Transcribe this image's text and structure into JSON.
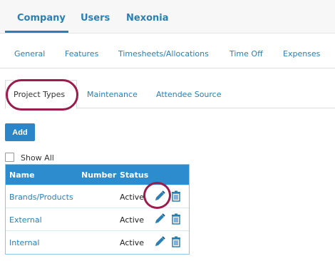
{
  "top_tabs": [
    "Company",
    "Users",
    "Nexonia"
  ],
  "sub_nav": [
    "General",
    "Features",
    "Timesheets/Allocations",
    "Time Off",
    "Expenses"
  ],
  "inner_tabs": [
    "Project Types",
    "Maintenance",
    "Attendee Source"
  ],
  "add_label": "Add",
  "show_all_label": "Show All",
  "table": {
    "headers": {
      "name": "Name",
      "number": "Number",
      "status": "Status"
    },
    "rows": [
      {
        "name": "Brands/Products",
        "status": "Active"
      },
      {
        "name": "External",
        "status": "Active"
      },
      {
        "name": "Internal",
        "status": "Active"
      }
    ]
  },
  "colors": {
    "accent": "#2a7fb4",
    "header": "#2d8ccd",
    "highlight_ring": "#9b1b4c"
  },
  "icons": [
    "pencil-edit-icon",
    "trash-icon"
  ]
}
